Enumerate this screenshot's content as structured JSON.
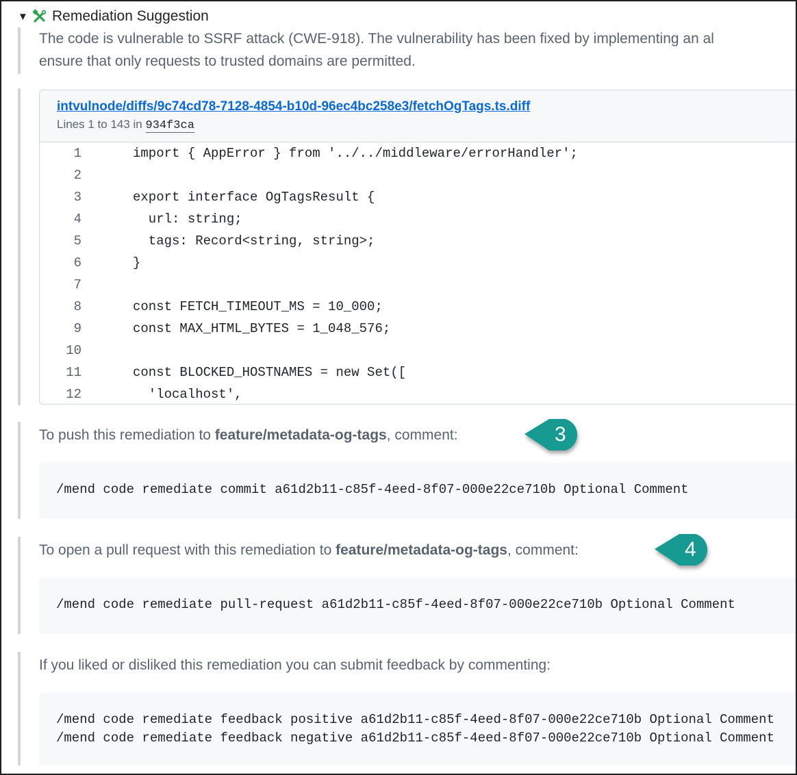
{
  "summary": {
    "toggle_icon": "triangle-down-icon",
    "icon": "tools-icon",
    "icon_color": "#2da44e",
    "title": "Remediation Suggestion"
  },
  "description": {
    "line1": "The code is vulnerable to SSRF attack (CWE-918). The vulnerability has been fixed by implementing an al",
    "line2": "ensure that only requests to trusted domains are permitted."
  },
  "diff": {
    "path": "intvulnode/diffs/9c74cd78-7128-4854-b10d-96ec4bc258e3/fetchOgTags.ts.diff",
    "lines_prefix": "Lines 1 to 143 in",
    "sha": "934f3ca",
    "code": [
      {
        "n": "1",
        "text": "import { AppError } from '../../middleware/errorHandler';"
      },
      {
        "n": "2",
        "text": ""
      },
      {
        "n": "3",
        "text": "export interface OgTagsResult {"
      },
      {
        "n": "4",
        "text": "  url: string;"
      },
      {
        "n": "5",
        "text": "  tags: Record<string, string>;"
      },
      {
        "n": "6",
        "text": "}"
      },
      {
        "n": "7",
        "text": ""
      },
      {
        "n": "8",
        "text": "const FETCH_TIMEOUT_MS = 10_000;"
      },
      {
        "n": "9",
        "text": "const MAX_HTML_BYTES = 1_048_576;"
      },
      {
        "n": "10",
        "text": ""
      },
      {
        "n": "11",
        "text": "const BLOCKED_HOSTNAMES = new Set(["
      },
      {
        "n": "12",
        "text": "  'localhost',"
      }
    ]
  },
  "push": {
    "prefix": "To push this remediation to ",
    "branch": "feature/metadata-og-tags",
    "suffix": ", comment:",
    "command": "/mend code remediate commit a61d2b11-c85f-4eed-8f07-000e22ce710b Optional Comment",
    "callout": "3"
  },
  "pull_request": {
    "prefix": "To open a pull request with this remediation to ",
    "branch": "feature/metadata-og-tags",
    "suffix": ", comment:",
    "command": "/mend code remediate pull-request a61d2b11-c85f-4eed-8f07-000e22ce710b Optional Comment",
    "callout": "4"
  },
  "feedback": {
    "text": "If you liked or disliked this remediation you can submit feedback by commenting:",
    "command_positive": "/mend code remediate feedback positive a61d2b11-c85f-4eed-8f07-000e22ce710b Optional Comment",
    "command_negative": "/mend code remediate feedback negative a61d2b11-c85f-4eed-8f07-000e22ce710b Optional Comment"
  },
  "colors": {
    "callout_fill": "#169a91",
    "link": "#0969da",
    "muted_text": "#59636e"
  }
}
